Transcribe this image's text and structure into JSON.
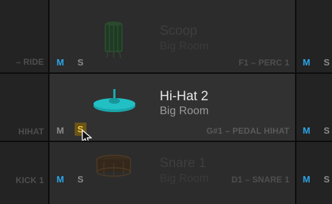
{
  "pads": {
    "left": [
      {
        "assignment": "– RIDE"
      },
      {
        "assignment": "HIHAT"
      },
      {
        "assignment": "KICK 1"
      }
    ],
    "center": [
      {
        "name": "Scoop",
        "category": "Big Room",
        "assignment": "F1 – PERC 1",
        "mute_label": "M",
        "solo_label": "S",
        "icon": "tom-drum-icon"
      },
      {
        "name": "Hi-Hat 2",
        "category": "Big Room",
        "assignment": "G#1 – PEDAL HIHAT",
        "mute_label": "M",
        "solo_label": "S",
        "icon": "hihat-cymbal-icon"
      },
      {
        "name": "Snare 1",
        "category": "Big Room",
        "assignment": "D1 – SNARE 1",
        "mute_label": "M",
        "solo_label": "S",
        "icon": "snare-drum-icon"
      }
    ],
    "right": [
      {
        "mute_label": "M",
        "solo_label": "S"
      },
      {
        "mute_label": "M",
        "solo_label": "S"
      },
      {
        "mute_label": "M",
        "solo_label": "S"
      }
    ]
  },
  "colors": {
    "mute_active": "#2aa5e8",
    "solo_active": "#f4c542",
    "hihat_icon": "#1bb3b8"
  },
  "active_pad": "Hi-Hat 2",
  "pointer": "arrow-cursor-icon"
}
